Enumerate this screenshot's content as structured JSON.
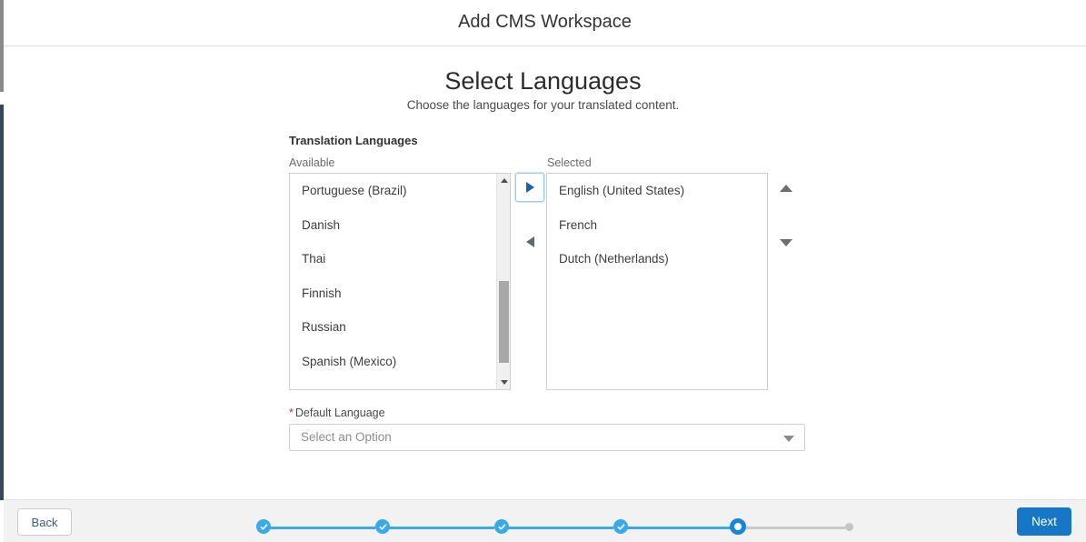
{
  "window": {
    "title": "Add CMS Workspace"
  },
  "page": {
    "heading": "Select Languages",
    "subheading": "Choose the languages for your translated content."
  },
  "form": {
    "group_label": "Translation Languages",
    "available_label": "Available",
    "selected_label": "Selected",
    "available_languages": [
      "Portuguese (Brazil)",
      "Danish",
      "Thai",
      "Finnish",
      "Russian",
      "Spanish (Mexico)"
    ],
    "selected_languages": [
      "English (United States)",
      "French",
      "Dutch (Netherlands)"
    ],
    "default_language": {
      "required_marker": "*",
      "label": "Default Language",
      "value": "",
      "placeholder": "Select an Option"
    }
  },
  "footer": {
    "back_label": "Back",
    "next_label": "Next",
    "stepper": {
      "steps": [
        {
          "state": "done"
        },
        {
          "state": "done"
        },
        {
          "state": "done"
        },
        {
          "state": "done"
        },
        {
          "state": "current"
        },
        {
          "state": "todo"
        }
      ],
      "current_index": 5,
      "total": 6
    }
  },
  "colors": {
    "accent_blue": "#1577c6",
    "step_done": "#3aa9e8",
    "step_current": "#1a84d8",
    "step_todo": "#c4c4c4",
    "required_red": "#a33a3a",
    "sidebar_navy": "#36465d"
  }
}
